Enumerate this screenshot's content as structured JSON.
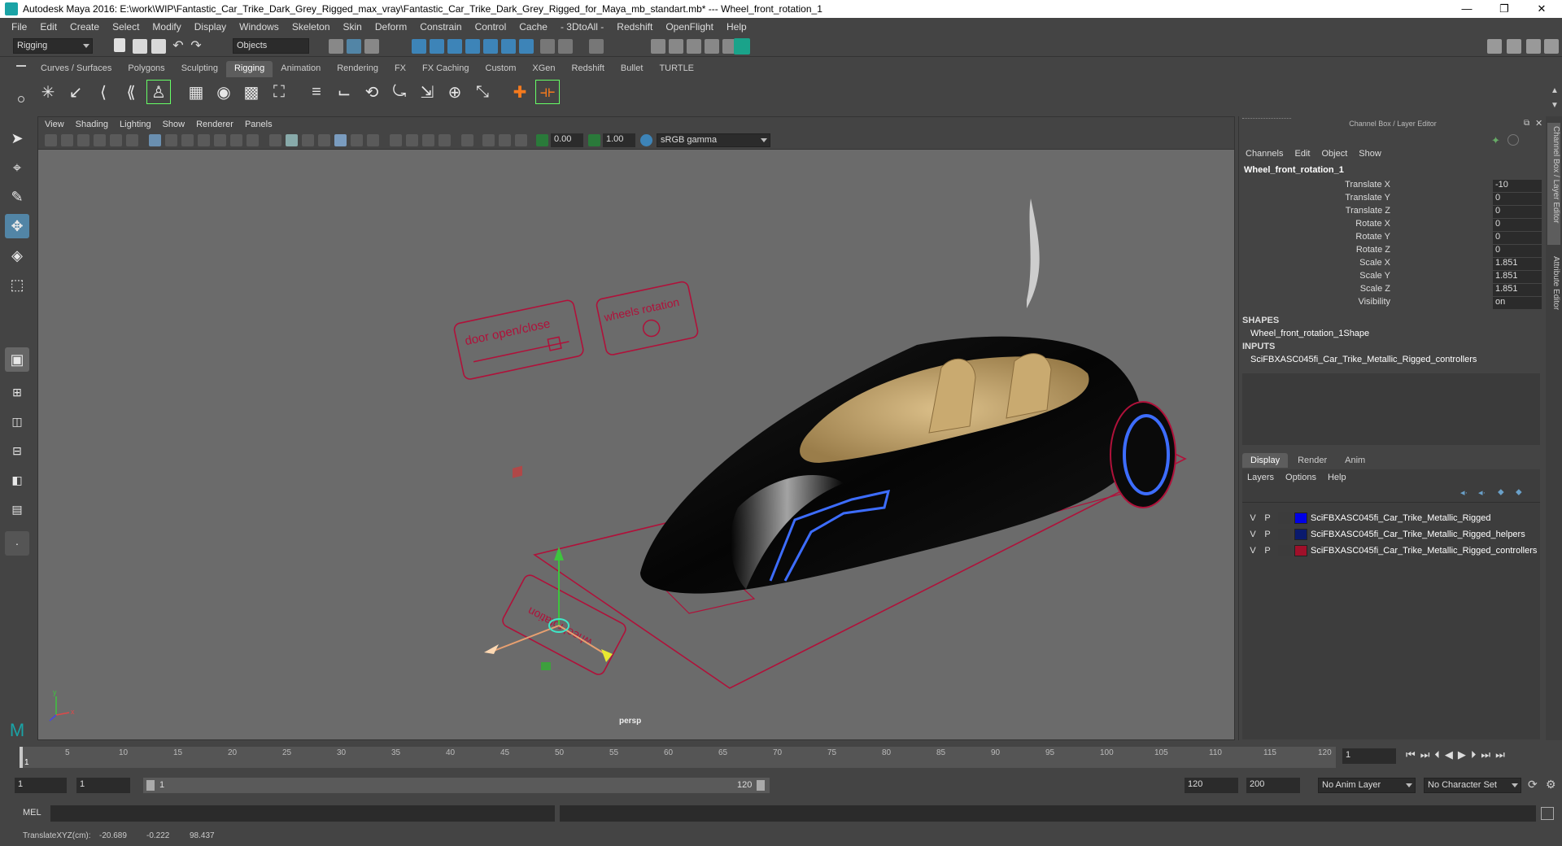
{
  "window": {
    "title": "Autodesk Maya 2016: E:\\work\\WIP\\Fantastic_Car_Trike_Dark_Grey_Rigged_max_vray\\Fantastic_Car_Trike_Dark_Grey_Rigged_for_Maya_mb_standart.mb*   ---   Wheel_front_rotation_1",
    "minimize": "—",
    "maximize": "❐",
    "close": "✕"
  },
  "menubar": [
    "File",
    "Edit",
    "Create",
    "Select",
    "Modify",
    "Display",
    "Windows",
    "Skeleton",
    "Skin",
    "Deform",
    "Constrain",
    "Control",
    "Cache",
    "- 3DtoAll -",
    "Redshift",
    "OpenFlight",
    "Help"
  ],
  "statusline": {
    "mode": "Rigging",
    "selection_mask": "Objects"
  },
  "shelf_tabs": [
    "Curves / Surfaces",
    "Polygons",
    "Sculpting",
    "Rigging",
    "Animation",
    "Rendering",
    "FX",
    "FX Caching",
    "Custom",
    "XGen",
    "Redshift",
    "Bullet",
    "TURTLE"
  ],
  "shelf_active": "Rigging",
  "viewport": {
    "menu": [
      "View",
      "Shading",
      "Lighting",
      "Show",
      "Renderer",
      "Panels"
    ],
    "exposure": "0.00",
    "gamma": "1.00",
    "colorspace": "sRGB gamma",
    "camera_label": "persp",
    "controller_labels": {
      "door": "door open/close",
      "wheels": "wheels rotation",
      "wheel": "wheel rotation"
    }
  },
  "channel_box": {
    "header": "Channel Box / Layer Editor",
    "menu": [
      "Channels",
      "Edit",
      "Object",
      "Show"
    ],
    "object_name": "Wheel_front_rotation_1",
    "channels": [
      {
        "label": "Translate X",
        "value": "-10"
      },
      {
        "label": "Translate Y",
        "value": "0"
      },
      {
        "label": "Translate Z",
        "value": "0"
      },
      {
        "label": "Rotate X",
        "value": "0"
      },
      {
        "label": "Rotate Y",
        "value": "0"
      },
      {
        "label": "Rotate Z",
        "value": "0"
      },
      {
        "label": "Scale X",
        "value": "1.851"
      },
      {
        "label": "Scale Y",
        "value": "1.851"
      },
      {
        "label": "Scale Z",
        "value": "1.851"
      },
      {
        "label": "Visibility",
        "value": "on"
      }
    ],
    "shapes_title": "SHAPES",
    "shape_name": "Wheel_front_rotation_1Shape",
    "inputs_title": "INPUTS",
    "input_name": "SciFBXASC045fi_Car_Trike_Metallic_Rigged_controllers"
  },
  "layer_editor": {
    "tabs": [
      "Display",
      "Render",
      "Anim"
    ],
    "active_tab": "Display",
    "menu": [
      "Layers",
      "Options",
      "Help"
    ],
    "layers": [
      {
        "v": "V",
        "p": "P",
        "name": "SciFBXASC045fi_Car_Trike_Metallic_Rigged",
        "color": "#0000e6"
      },
      {
        "v": "V",
        "p": "P",
        "name": "SciFBXASC045fi_Car_Trike_Metallic_Rigged_helpers",
        "color": "#0a1a6e"
      },
      {
        "v": "V",
        "p": "P",
        "name": "SciFBXASC045fi_Car_Trike_Metallic_Rigged_controllers",
        "color": "#a0102a"
      }
    ]
  },
  "side_tabs": [
    "Channel Box / Layer Editor",
    "Attribute Editor"
  ],
  "timeline": {
    "ticks": [
      "1",
      "5",
      "10",
      "15",
      "20",
      "25",
      "30",
      "35",
      "40",
      "45",
      "50",
      "55",
      "60",
      "65",
      "70",
      "75",
      "80",
      "85",
      "90",
      "95",
      "100",
      "105",
      "110",
      "115",
      "120"
    ],
    "current_frame": "1"
  },
  "range": {
    "start": "1",
    "playback_start": "1",
    "slider_start": "1",
    "slider_end": "120",
    "playback_end": "120",
    "end": "200",
    "anim_layer": "No Anim Layer",
    "character_set": "No Character Set"
  },
  "command_line": {
    "lang": "MEL"
  },
  "help_line": {
    "label": "TranslateXYZ(cm):",
    "x": "-20.689",
    "y": "-0.222",
    "z": "98.437"
  },
  "colors": {
    "accent": "#5285a6",
    "controller": "#b0113a",
    "car_body": "#080808",
    "interior": "#c8a66e",
    "neon": "#3d6dff"
  }
}
